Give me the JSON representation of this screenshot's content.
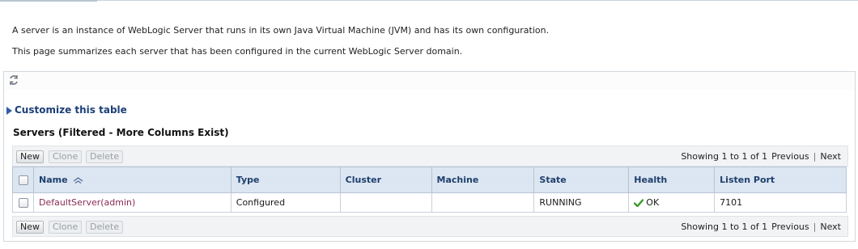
{
  "intro": {
    "line1": "A server is an instance of WebLogic Server that runs in its own Java Virtual Machine (JVM) and has its own configuration.",
    "line2": "This page summarizes each server that has been configured in the current WebLogic Server domain."
  },
  "customize_label": "Customize this table",
  "table_title": "Servers (Filtered - More Columns Exist)",
  "toolbar": {
    "new_label": "New",
    "clone_label": "Clone",
    "delete_label": "Delete",
    "showing": "Showing 1 to 1 of 1",
    "previous": "Previous",
    "separator": "|",
    "next": "Next"
  },
  "columns": [
    "Name",
    "Type",
    "Cluster",
    "Machine",
    "State",
    "Health",
    "Listen Port"
  ],
  "rows": [
    {
      "name": "DefaultServer(admin)",
      "type": "Configured",
      "cluster": "",
      "machine": "",
      "state": "RUNNING",
      "health": "OK",
      "listen_port": "7101"
    }
  ],
  "icons": {
    "refresh": "refresh-icon",
    "health_ok": "checkmark-icon",
    "sort": "sort-ascending-icon",
    "expand": "expand-triangle-icon"
  },
  "colors": {
    "header_bg": "#dce6f2",
    "link": "#8a2a55",
    "accent": "#1c3f78",
    "ok": "#3a9a2a"
  }
}
